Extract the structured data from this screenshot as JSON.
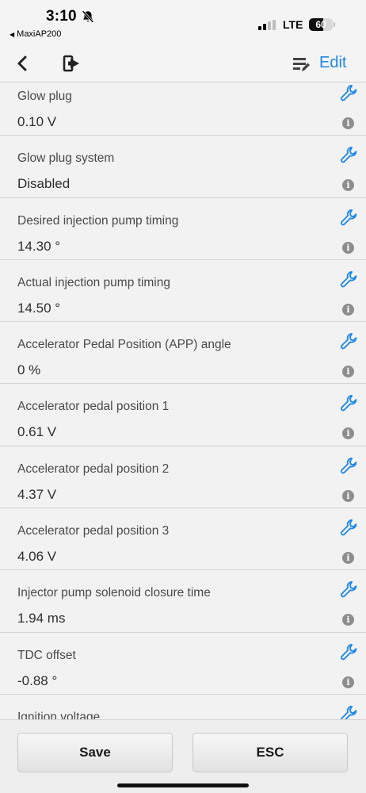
{
  "status_bar": {
    "time": "3:10",
    "back_app": "MaxiAP200",
    "network": "LTE",
    "battery": "60",
    "battery_level": 0.6
  },
  "nav": {
    "edit_label": "Edit",
    "icons": [
      "back-chevron",
      "exit-door",
      "list-edit"
    ]
  },
  "rows": [
    {
      "label": "Glow plug",
      "value": "0.10 V"
    },
    {
      "label": "Glow plug system",
      "value": "Disabled"
    },
    {
      "label": "Desired injection pump timing",
      "value": "14.30 °"
    },
    {
      "label": "Actual injection pump timing",
      "value": "14.50 °"
    },
    {
      "label": "Accelerator Pedal Position (APP) angle",
      "value": "0 %"
    },
    {
      "label": "Accelerator pedal position 1",
      "value": "0.61 V"
    },
    {
      "label": "Accelerator pedal position 2",
      "value": "4.37 V"
    },
    {
      "label": "Accelerator pedal position 3",
      "value": "4.06 V"
    },
    {
      "label": "Injector pump solenoid closure time",
      "value": "1.94 ms"
    },
    {
      "label": "TDC offset",
      "value": "-0.88 °"
    },
    {
      "label": "Ignition voltage",
      "value": ""
    }
  ],
  "footer": {
    "save_label": "Save",
    "esc_label": "ESC"
  },
  "colors": {
    "accent": "#1e88e5",
    "info_icon": "#8d8d8d",
    "background": "#f2f2f2"
  }
}
